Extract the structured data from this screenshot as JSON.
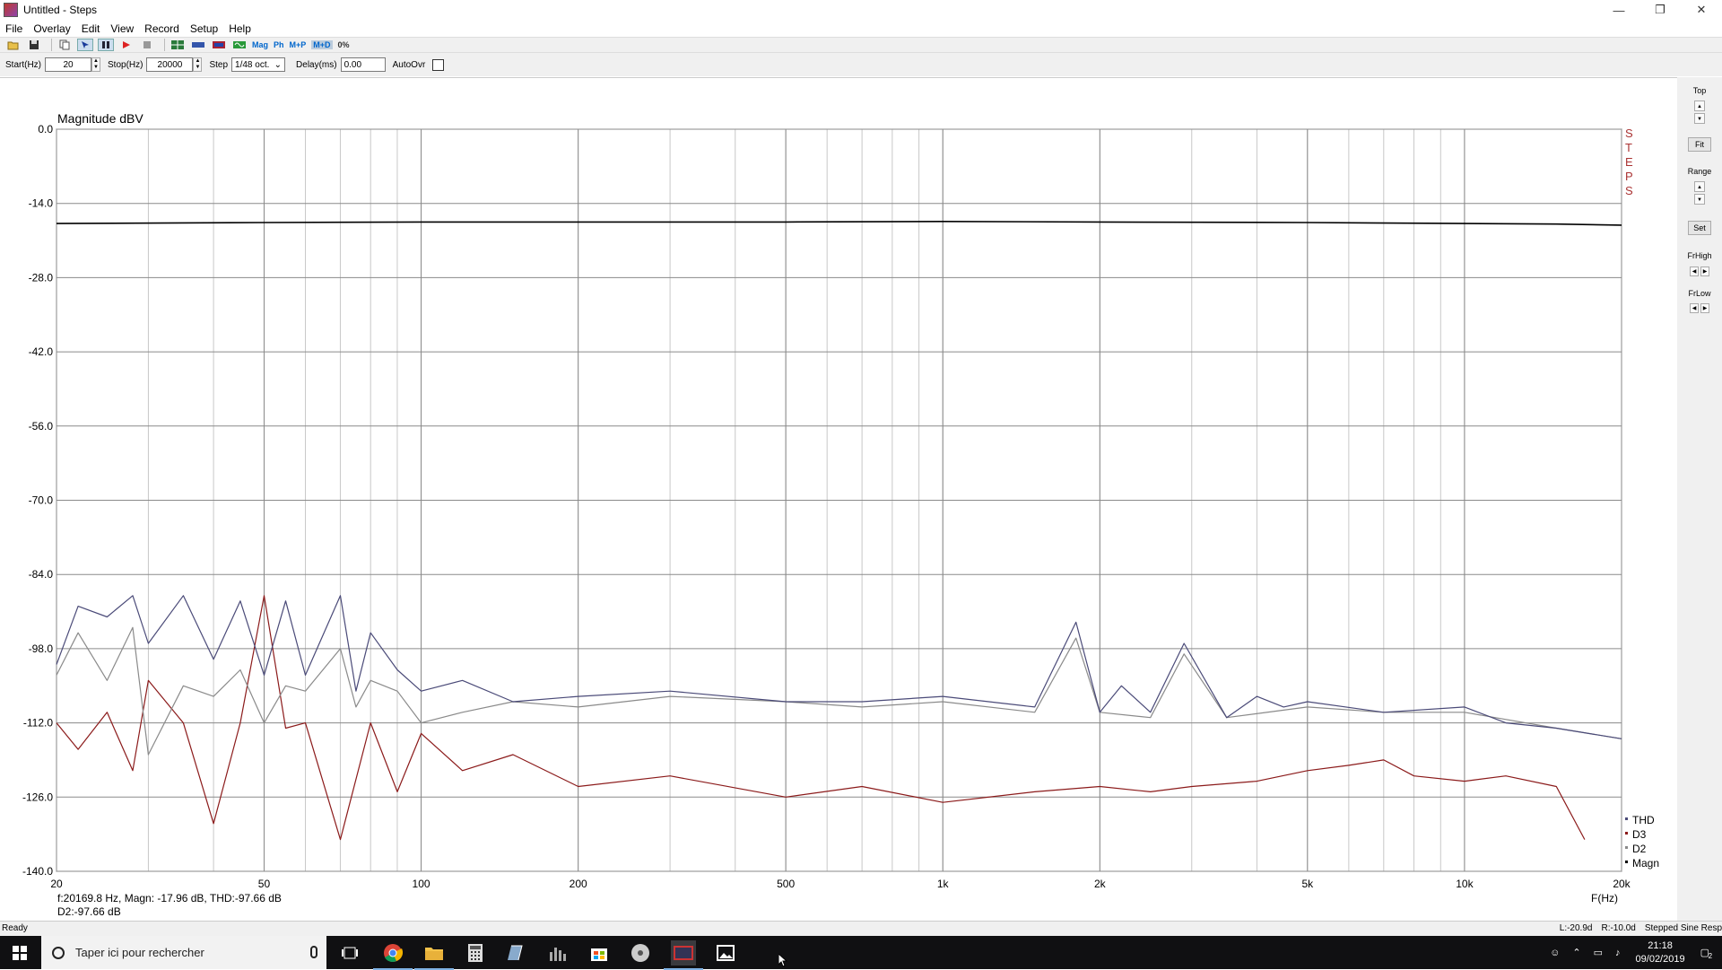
{
  "window": {
    "title": "Untitled - Steps",
    "minimize": "—",
    "maximize": "❐",
    "close": "✕"
  },
  "menu": [
    "File",
    "Overlay",
    "Edit",
    "View",
    "Record",
    "Setup",
    "Help"
  ],
  "toolbar": {
    "mag": "Mag",
    "ph": "Ph",
    "mp": "M+P",
    "md": "M+D",
    "pct": "0%"
  },
  "params": {
    "start_label": "Start(Hz)",
    "start_value": "20",
    "stop_label": "Stop(Hz)",
    "stop_value": "20000",
    "step_label": "Step",
    "step_value": "1/48 oct.",
    "delay_label": "Delay(ms)",
    "delay_value": "0.00",
    "autoovr_label": "AutoOvr"
  },
  "right_panel": {
    "top": "Top",
    "fit": "Fit",
    "range": "Range",
    "set": "Set",
    "frhigh": "FrHigh",
    "frlow": "FrLow"
  },
  "readout": {
    "line1": "f:20169.8 Hz, Magn: -17.96 dB, THD:-97.66  dB",
    "line2": "D2:-97.66 dB"
  },
  "watermark": [
    "S",
    "T",
    "E",
    "P",
    "S"
  ],
  "status": {
    "left": "Ready",
    "lr": "L:-20.9d",
    "rr": "R:-10.0d",
    "mode": "Stepped Sine Resp"
  },
  "taskbar": {
    "search_placeholder": "Taper ici pour rechercher",
    "time": "21:18",
    "date": "09/02/2019",
    "notif_count": "2"
  },
  "colors": {
    "magn": "#000000",
    "d3": "#8b1a1a",
    "d2": "#8a8a8a",
    "thd": "#4a4a78"
  },
  "chart_data": {
    "type": "line",
    "ylabel": "Magnitude dBV",
    "xlabel": "F(Hz)",
    "xscale": "log",
    "xlim": [
      20,
      20000
    ],
    "ylim": [
      -140,
      0
    ],
    "yticks": [
      "0.0",
      "-14.0",
      "-28.0",
      "-42.0",
      "-56.0",
      "-70.0",
      "-84.0",
      "-98.0",
      "-112.0",
      "-126.0",
      "-140.0"
    ],
    "xticks": [
      {
        "v": 20,
        "label": "20"
      },
      {
        "v": 50,
        "label": "50"
      },
      {
        "v": 100,
        "label": "100"
      },
      {
        "v": 200,
        "label": "200"
      },
      {
        "v": 500,
        "label": "500"
      },
      {
        "v": 1000,
        "label": "1k"
      },
      {
        "v": 2000,
        "label": "2k"
      },
      {
        "v": 5000,
        "label": "5k"
      },
      {
        "v": 10000,
        "label": "10k"
      },
      {
        "v": 20000,
        "label": "20k"
      }
    ],
    "legend": [
      "THD",
      "D3",
      "D2",
      "Magn"
    ],
    "series": [
      {
        "name": "Magn",
        "x": [
          20,
          50,
          100,
          200,
          500,
          1000,
          2000,
          5000,
          10000,
          15000,
          20000
        ],
        "y": [
          -17.8,
          -17.6,
          -17.5,
          -17.5,
          -17.5,
          -17.4,
          -17.5,
          -17.6,
          -17.8,
          -17.9,
          -18.1
        ]
      },
      {
        "name": "THD",
        "x": [
          20,
          22,
          25,
          28,
          30,
          35,
          40,
          45,
          50,
          55,
          60,
          70,
          75,
          80,
          90,
          100,
          120,
          150,
          200,
          300,
          500,
          700,
          1000,
          1500,
          1800,
          2000,
          2200,
          2500,
          2900,
          3500,
          4000,
          4500,
          5000,
          7000,
          10000,
          12000,
          15000,
          20000
        ],
        "y": [
          -101,
          -90,
          -92,
          -88,
          -97,
          -88,
          -100,
          -89,
          -103,
          -89,
          -103,
          -88,
          -106,
          -95,
          -102,
          -106,
          -104,
          -108,
          -107,
          -106,
          -108,
          -108,
          -107,
          -109,
          -93,
          -110,
          -105,
          -110,
          -97,
          -111,
          -107,
          -109,
          -108,
          -110,
          -109,
          -112,
          -113,
          -115
        ]
      },
      {
        "name": "D2",
        "x": [
          20,
          22,
          25,
          28,
          30,
          35,
          40,
          45,
          50,
          55,
          60,
          70,
          75,
          80,
          90,
          100,
          120,
          150,
          200,
          300,
          500,
          700,
          1000,
          1500,
          1800,
          2000,
          2500,
          2900,
          3500,
          5000,
          7000,
          10000,
          15000,
          20000
        ],
        "y": [
          -103,
          -95,
          -104,
          -94,
          -118,
          -105,
          -107,
          -102,
          -112,
          -105,
          -106,
          -98,
          -109,
          -104,
          -106,
          -112,
          -110,
          -108,
          -109,
          -107,
          -108,
          -109,
          -108,
          -110,
          -96,
          -110,
          -111,
          -99,
          -111,
          -109,
          -110,
          -110,
          -113,
          -115
        ]
      },
      {
        "name": "D3",
        "x": [
          20,
          22,
          25,
          28,
          30,
          35,
          40,
          45,
          50,
          55,
          60,
          70,
          80,
          90,
          100,
          120,
          150,
          200,
          300,
          500,
          700,
          1000,
          1500,
          2000,
          2500,
          3000,
          4000,
          5000,
          6000,
          7000,
          8000,
          10000,
          12000,
          15000,
          17000
        ],
        "y": [
          -112,
          -117,
          -110,
          -121,
          -104,
          -112,
          -131,
          -112,
          -88,
          -113,
          -112,
          -134,
          -112,
          -125,
          -114,
          -121,
          -118,
          -124,
          -122,
          -126,
          -124,
          -127,
          -125,
          -124,
          -125,
          -124,
          -123,
          -121,
          -120,
          -119,
          -122,
          -123,
          -122,
          -124,
          -134
        ]
      }
    ]
  }
}
